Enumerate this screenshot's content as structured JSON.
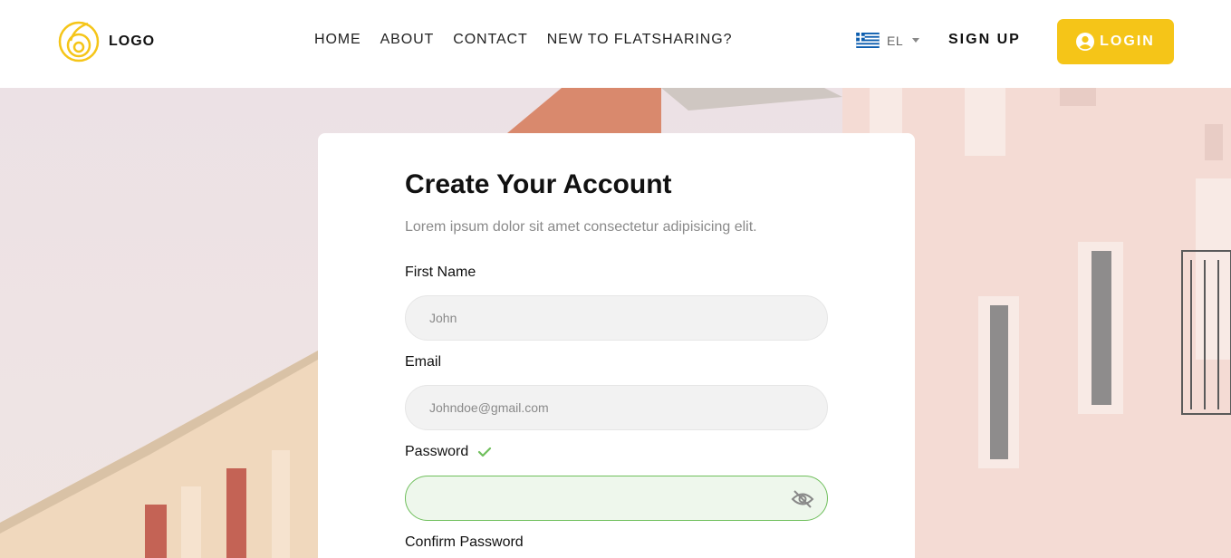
{
  "header": {
    "logo_text": "LOGO",
    "nav": [
      "HOME",
      "ABOUT",
      "CONTACT",
      "NEW TO FLATSHARING?"
    ],
    "language": "EL",
    "signup_label": "SIGN UP",
    "login_label": "LOGIN"
  },
  "form": {
    "title": "Create Your Account",
    "subtitle": "Lorem ipsum dolor sit amet consectetur adipisicing elit.",
    "first_name_label": "First Name",
    "first_name_placeholder": "John",
    "email_label": "Email",
    "email_placeholder": "Johndoe@gmail.com",
    "password_label": "Password",
    "confirm_password_label": "Confirm Password"
  },
  "colors": {
    "accent": "#f5c518",
    "valid": "#6fbf5c"
  },
  "icons": {
    "logo": "spiral-logo-icon",
    "flag": "greek-flag-icon",
    "login": "user-circle-icon",
    "password_valid": "check-icon",
    "password_toggle": "eye-off-icon"
  }
}
